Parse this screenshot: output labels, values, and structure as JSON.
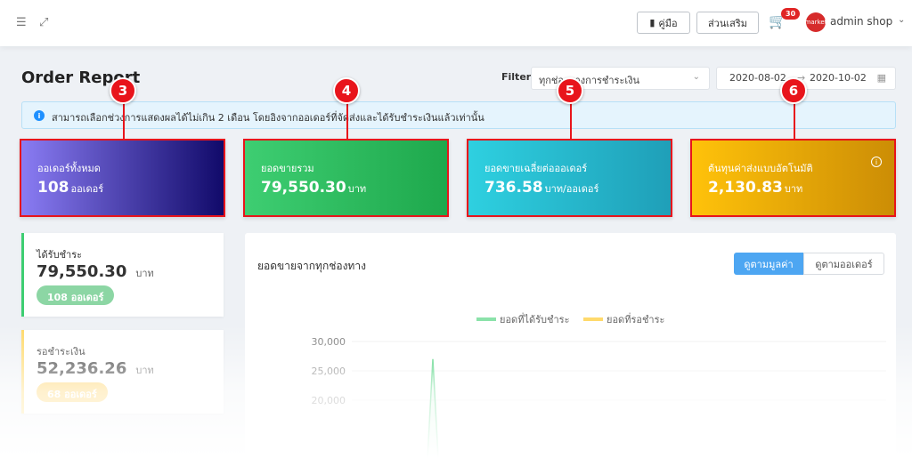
{
  "topbar": {
    "manual_label": "คู่มือ",
    "addons_label": "ส่วนเสริม",
    "cart_count": "30",
    "avatar_text": "market",
    "user_name": "admin shop"
  },
  "page": {
    "title": "Order Report",
    "filter_label": "Filter",
    "filter_value": "ทุกช่องทางการชำระเงิน",
    "date_from": "2020-08-02",
    "date_to": "2020-10-02",
    "info_text": "สามารถเลือกช่วงการแสดงผลได้ไม่เกิน 2 เดือน โดยอิงจากออเดอร์ที่จัดส่งและได้รับชำระเงินแล้วเท่านั้น"
  },
  "markers": [
    "3",
    "4",
    "5",
    "6"
  ],
  "cards": [
    {
      "title": "ออเดอร์ทั้งหมด",
      "value": "108",
      "unit": "ออเดอร์"
    },
    {
      "title": "ยอดขายรวม",
      "value": "79,550.30",
      "unit": "บาท"
    },
    {
      "title": "ยอดขายเฉลี่ยต่อออเดอร์",
      "value": "736.58",
      "unit": "บาท/ออเดอร์"
    },
    {
      "title": "ต้นทุนค่าส่งแบบอัตโนมัติ",
      "value": "2,130.83",
      "unit": "บาท"
    }
  ],
  "side": {
    "paid": {
      "title": "ได้รับชำระ",
      "value": "79,550.30",
      "unit": "บาท",
      "pill": "108 ออเดอร์"
    },
    "pending": {
      "title": "รอชำระเงิน",
      "value": "52,236.26",
      "unit": "บาท",
      "pill": "68 ออเดอร์"
    }
  },
  "chart_panel": {
    "title": "ยอดขายจากทุกช่องทาง",
    "toggle_value": "ดูตามมูลค่า",
    "toggle_orders": "ดูตามออเดอร์"
  },
  "chart_data": {
    "type": "line",
    "series": [
      {
        "name": "ยอดที่ได้รับชำระ",
        "color": "#3ece72"
      },
      {
        "name": "ยอดที่รอชำระ",
        "color": "#ffc20a"
      }
    ],
    "yticks": [
      "30,000",
      "25,000",
      "20,000"
    ],
    "ylim": [
      20000,
      30000
    ],
    "peak": 27000
  },
  "colors": {
    "accent": "#4da6f2",
    "callout": "#e8141b"
  }
}
